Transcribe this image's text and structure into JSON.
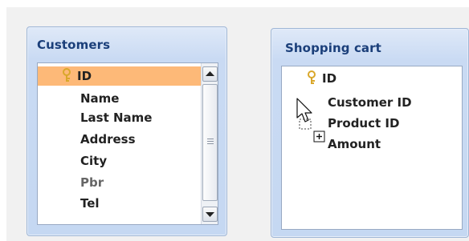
{
  "customers": {
    "title": "Customers",
    "fields": [
      "ID",
      "Name",
      "Last Name",
      "Address",
      "City",
      "Pbr",
      "Tel"
    ],
    "primary_key": "ID"
  },
  "shopping_cart": {
    "title": "Shopping cart",
    "fields": [
      "ID",
      "Customer ID",
      "Product ID",
      "Amount"
    ],
    "primary_key": "ID"
  },
  "icons": {
    "key": "key-icon",
    "scroll_up": "scroll-up-arrow-icon",
    "scroll_down": "scroll-down-arrow-icon",
    "drag_cursor": "drag-copy-cursor-icon"
  },
  "colors": {
    "window_bg": "#c9daf3",
    "title_text": "#1b3f7a",
    "selected_row": "#fdb978",
    "key_gold": "#d9a72a"
  }
}
